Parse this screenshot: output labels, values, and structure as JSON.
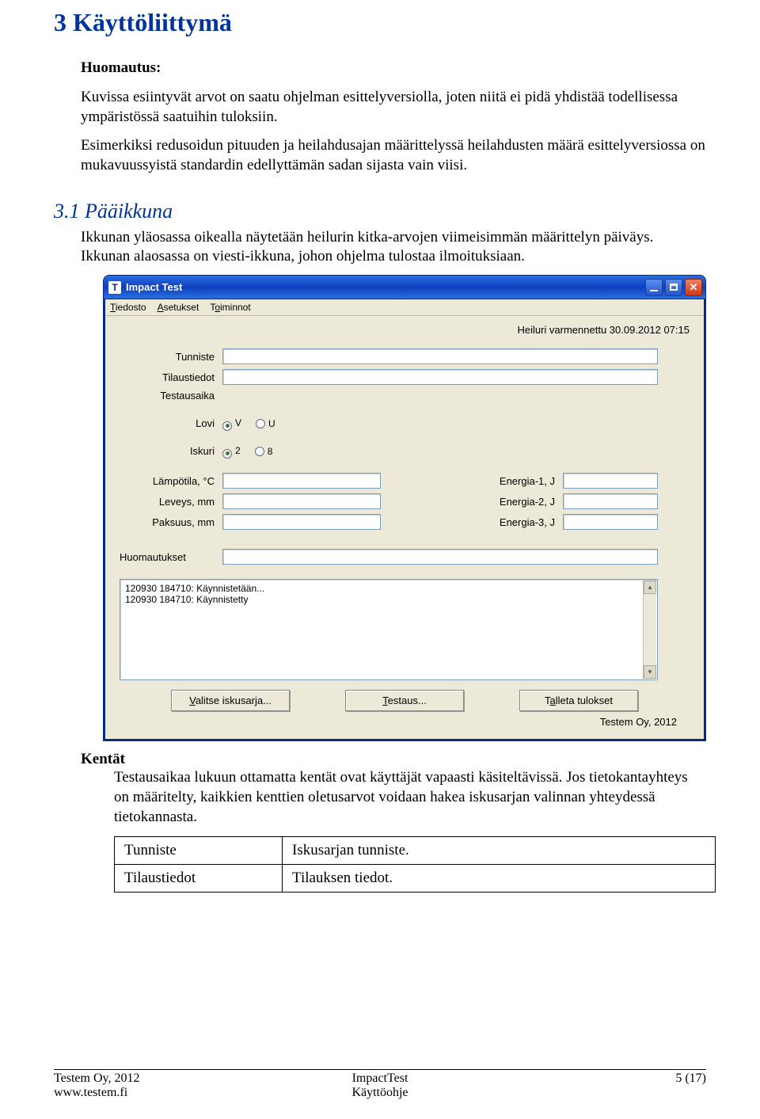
{
  "doc": {
    "h1": "3 Käyttöliittymä",
    "note_title": "Huomautus:",
    "para1": "Kuvissa esiintyvät arvot on saatu ohjelman esittelyversiolla, joten niitä ei pidä yhdistää todellisessa ympäristössä saatuihin tuloksiin.",
    "para2": "Esimerkiksi redusoidun pituuden ja heilahdusajan määrittelyssä heilahdusten määrä esittelyversiossa on mukavuussyistä standardin edellyttämän sadan sijasta vain viisi.",
    "h2": "3.1 Pääikkuna",
    "h2_para": "Ikkunan yläosassa oikealla näytetään heilurin kitka-arvojen viimeisimmän määrittelyn päiväys. Ikkunan alaosassa on viesti-ikkuna, johon ohjelma tulostaa ilmoituksiaan.",
    "kentat_title": "Kentät",
    "kentat_para": "Testausaikaa lukuun ottamatta kentät ovat käyttäjät vapaasti käsiteltävissä. Jos tietokantayhteys on määritelty, kaikkien kenttien oletusarvot voidaan hakea iskusarjan valinnan yhteydessä tietokannasta.",
    "fields": [
      {
        "name": "Tunniste",
        "desc": "Iskusarjan tunniste."
      },
      {
        "name": "Tilaustiedot",
        "desc": "Tilauksen tiedot."
      }
    ]
  },
  "win": {
    "icon_letter": "T",
    "title": "Impact Test",
    "menu": {
      "m0": "Tiedosto",
      "m1": "Asetukset",
      "m2": "Toiminnot"
    },
    "status_top": "Heiluri varmennettu 30.09.2012 07:15",
    "labels": {
      "tunniste": "Tunniste",
      "tilaustiedot": "Tilaustiedot",
      "testausaika": "Testausaika",
      "lovi": "Lovi",
      "iskuri": "Iskuri",
      "lampotila": "Lämpötila, °C",
      "leveys": "Leveys, mm",
      "paksuus": "Paksuus, mm",
      "energia1": "Energia-1, J",
      "energia2": "Energia-2, J",
      "energia3": "Energia-3, J",
      "huomautukset": "Huomautukset"
    },
    "radios": {
      "v": "V",
      "u": "U",
      "r2": "2",
      "r8": "8"
    },
    "log": "120930 184710: Käynnistetään...\n120930 184710: Käynnistetty",
    "buttons": {
      "b1": "Valitse iskusarja...",
      "b2": "Testaus...",
      "b3": "Talleta tulokset"
    },
    "brand": "Testem Oy, 2012"
  },
  "footer": {
    "l1": "Testem Oy, 2012",
    "l2": "www.testem.fi",
    "c1": "ImpactTest",
    "c2": "Käyttöohje",
    "r1": "5 (17)"
  }
}
